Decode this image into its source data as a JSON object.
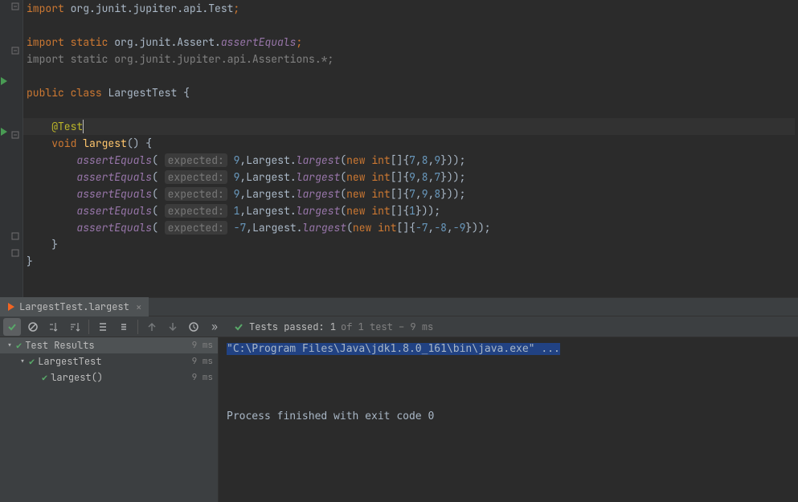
{
  "code": {
    "import_line1": {
      "kw": "import",
      "rest": " org.junit.jupiter.api.",
      "cls": "Test",
      "semi": ";"
    },
    "import_line2": {
      "kw": "import",
      "static": "static",
      "rest": " org.junit.Assert.",
      "ital": "assertEquals",
      "semi": ";"
    },
    "import_line3": {
      "kw": "import",
      "static": "static",
      "rest": " org.junit.jupiter.api.Assertions.*;"
    },
    "class_decl": {
      "public": "public",
      "class": "class",
      "name": "LargestTest",
      "brace": "{"
    },
    "annotation": "@Test",
    "method": {
      "void": "void",
      "name": "largest",
      "parens": "()",
      "brace": "{"
    },
    "a1": {
      "fn": "assertEquals",
      "hint": "expected:",
      "exp": "9",
      "cls": "Largest",
      "meth": "largest",
      "new": "new",
      "int": "int",
      "arr": "[]{",
      "args": [
        "7",
        "8",
        "9"
      ],
      "tail": "}));"
    },
    "a2": {
      "fn": "assertEquals",
      "hint": "expected:",
      "exp": "9",
      "cls": "Largest",
      "meth": "largest",
      "new": "new",
      "int": "int",
      "arr": "[]{",
      "args": [
        "9",
        "8",
        "7"
      ],
      "tail": "}));"
    },
    "a3": {
      "fn": "assertEquals",
      "hint": "expected:",
      "exp": "9",
      "cls": "Largest",
      "meth": "largest",
      "new": "new",
      "int": "int",
      "arr": "[]{",
      "args": [
        "7",
        "9",
        "8"
      ],
      "tail": "}));"
    },
    "a4": {
      "fn": "assertEquals",
      "hint": "expected:",
      "exp": "1",
      "cls": "Largest",
      "meth": "largest",
      "new": "new",
      "int": "int",
      "arr": "[]{",
      "args": [
        "1"
      ],
      "tail": "}));"
    },
    "a5": {
      "fn": "assertEquals",
      "hint": "expected:",
      "exp": "-7",
      "cls": "Largest",
      "meth": "largest",
      "new": "new",
      "int": "int",
      "arr": "[]{",
      "args": [
        "-7",
        "-8",
        "-9"
      ],
      "tail": "}));"
    },
    "close_method": "}",
    "close_class": "}"
  },
  "run_tab": {
    "label": "LargestTest.largest"
  },
  "summary": {
    "label": "Tests passed:",
    "count": "1",
    "rest": "of 1 test – 9 ms"
  },
  "tree": {
    "root": {
      "label": "Test Results",
      "time": "9 ms"
    },
    "suite": {
      "label": "LargestTest",
      "time": "9 ms"
    },
    "test": {
      "label": "largest()",
      "time": "9 ms"
    }
  },
  "console": {
    "line1": "\"C:\\Program Files\\Java\\jdk1.8.0_161\\bin\\java.exe\" ...",
    "line2": "Process finished with exit code 0"
  },
  "icons": {
    "run": "▶",
    "expand": "▽",
    "collapse": "▷"
  }
}
